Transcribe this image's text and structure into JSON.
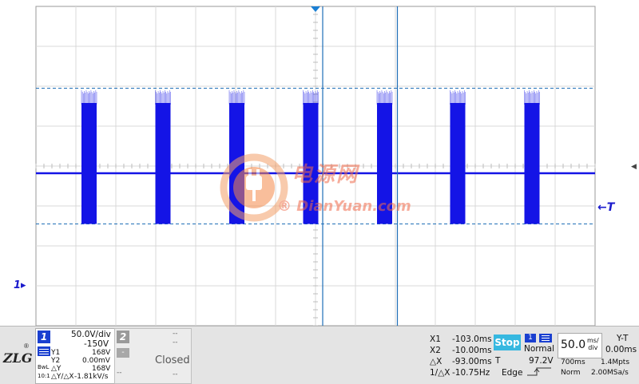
{
  "screen": {
    "ch1_marker": "1",
    "trigger_marker": "T",
    "watermark_cn": "电源网",
    "watermark_en": "® DianYuan.com",
    "colors": {
      "trace": "#1414e6",
      "cursor": "#1f6fb8",
      "grid": "#d8d8d8",
      "accent": "#36b8e0"
    },
    "waveform": {
      "baseline_level_divs": -0.18,
      "burst_high_divs": 1.9,
      "burst_low_divs": -1.45,
      "burst_centers_divs": [
        -5.67,
        -3.82,
        -1.97,
        -0.12,
        1.73,
        3.56,
        5.42
      ],
      "burst_width_divs": 0.38
    },
    "cursors": {
      "x1_divs": 0.18,
      "x2_divs": 2.05
    },
    "h_cursors_divs": [
      1.95,
      -1.45
    ]
  },
  "panel": {
    "logo_text": "ZLG",
    "logo_reg": "®",
    "ch1": {
      "number": "1",
      "scale": "50.0V/div",
      "offset": "-150V",
      "y1_label": "Y1",
      "y1_value": "168V",
      "y2_label": "Y2",
      "y2_value": "0.00mV",
      "dy_label": "△Y",
      "dy_value": "168V",
      "dydx_label": "△Y/△X",
      "dydx_value": "-1.81kV/s",
      "coupling": "BwL",
      "probe": "10:1"
    },
    "ch2": {
      "number": "2",
      "line1": "--",
      "line2": "--",
      "minus": "-",
      "status": "Closed",
      "line3": "--",
      "line4": "--"
    },
    "cursors": {
      "x1_label": "X1",
      "x1_value": "-103.0ms",
      "x2_label": "X2",
      "x2_value": "-10.00ms",
      "dx_label": "△X",
      "dx_value": "-93.00ms",
      "inv_label": "1/△X",
      "inv_value": "-10.75Hz"
    },
    "run_state": "Stop",
    "trigger": {
      "source": "1",
      "mode": "Normal",
      "t_label": "T",
      "level": "97.2V",
      "type": "Edge"
    },
    "timebase": {
      "value": "50.0",
      "unit_top": "ms/",
      "unit_bottom": "div",
      "mode": "Y-T",
      "delay": "0.00ms",
      "memory": "700ms",
      "points": "1.4Mpts",
      "acq": "Norm",
      "rate": "2.00MSa/s"
    }
  }
}
